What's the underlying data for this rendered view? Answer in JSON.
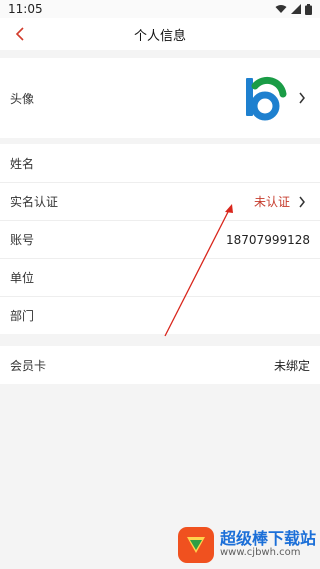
{
  "status": {
    "time": "11:05"
  },
  "header": {
    "title": "个人信息"
  },
  "avatar_row": {
    "label": "头像"
  },
  "info_rows": [
    {
      "label": "姓名",
      "value": ""
    },
    {
      "label": "实名认证",
      "value": "未认证"
    },
    {
      "label": "账号",
      "value": "18707999128"
    },
    {
      "label": "单位",
      "value": ""
    },
    {
      "label": "部门",
      "value": ""
    }
  ],
  "membership": {
    "label": "会员卡",
    "value": "未绑定"
  },
  "colors": {
    "accent_red": "#c63b2c",
    "avatar_blue": "#1e80cf",
    "avatar_green": "#1a9c46"
  },
  "watermark": {
    "title": "超级棒下载站",
    "url": "www.cjbwh.com"
  }
}
